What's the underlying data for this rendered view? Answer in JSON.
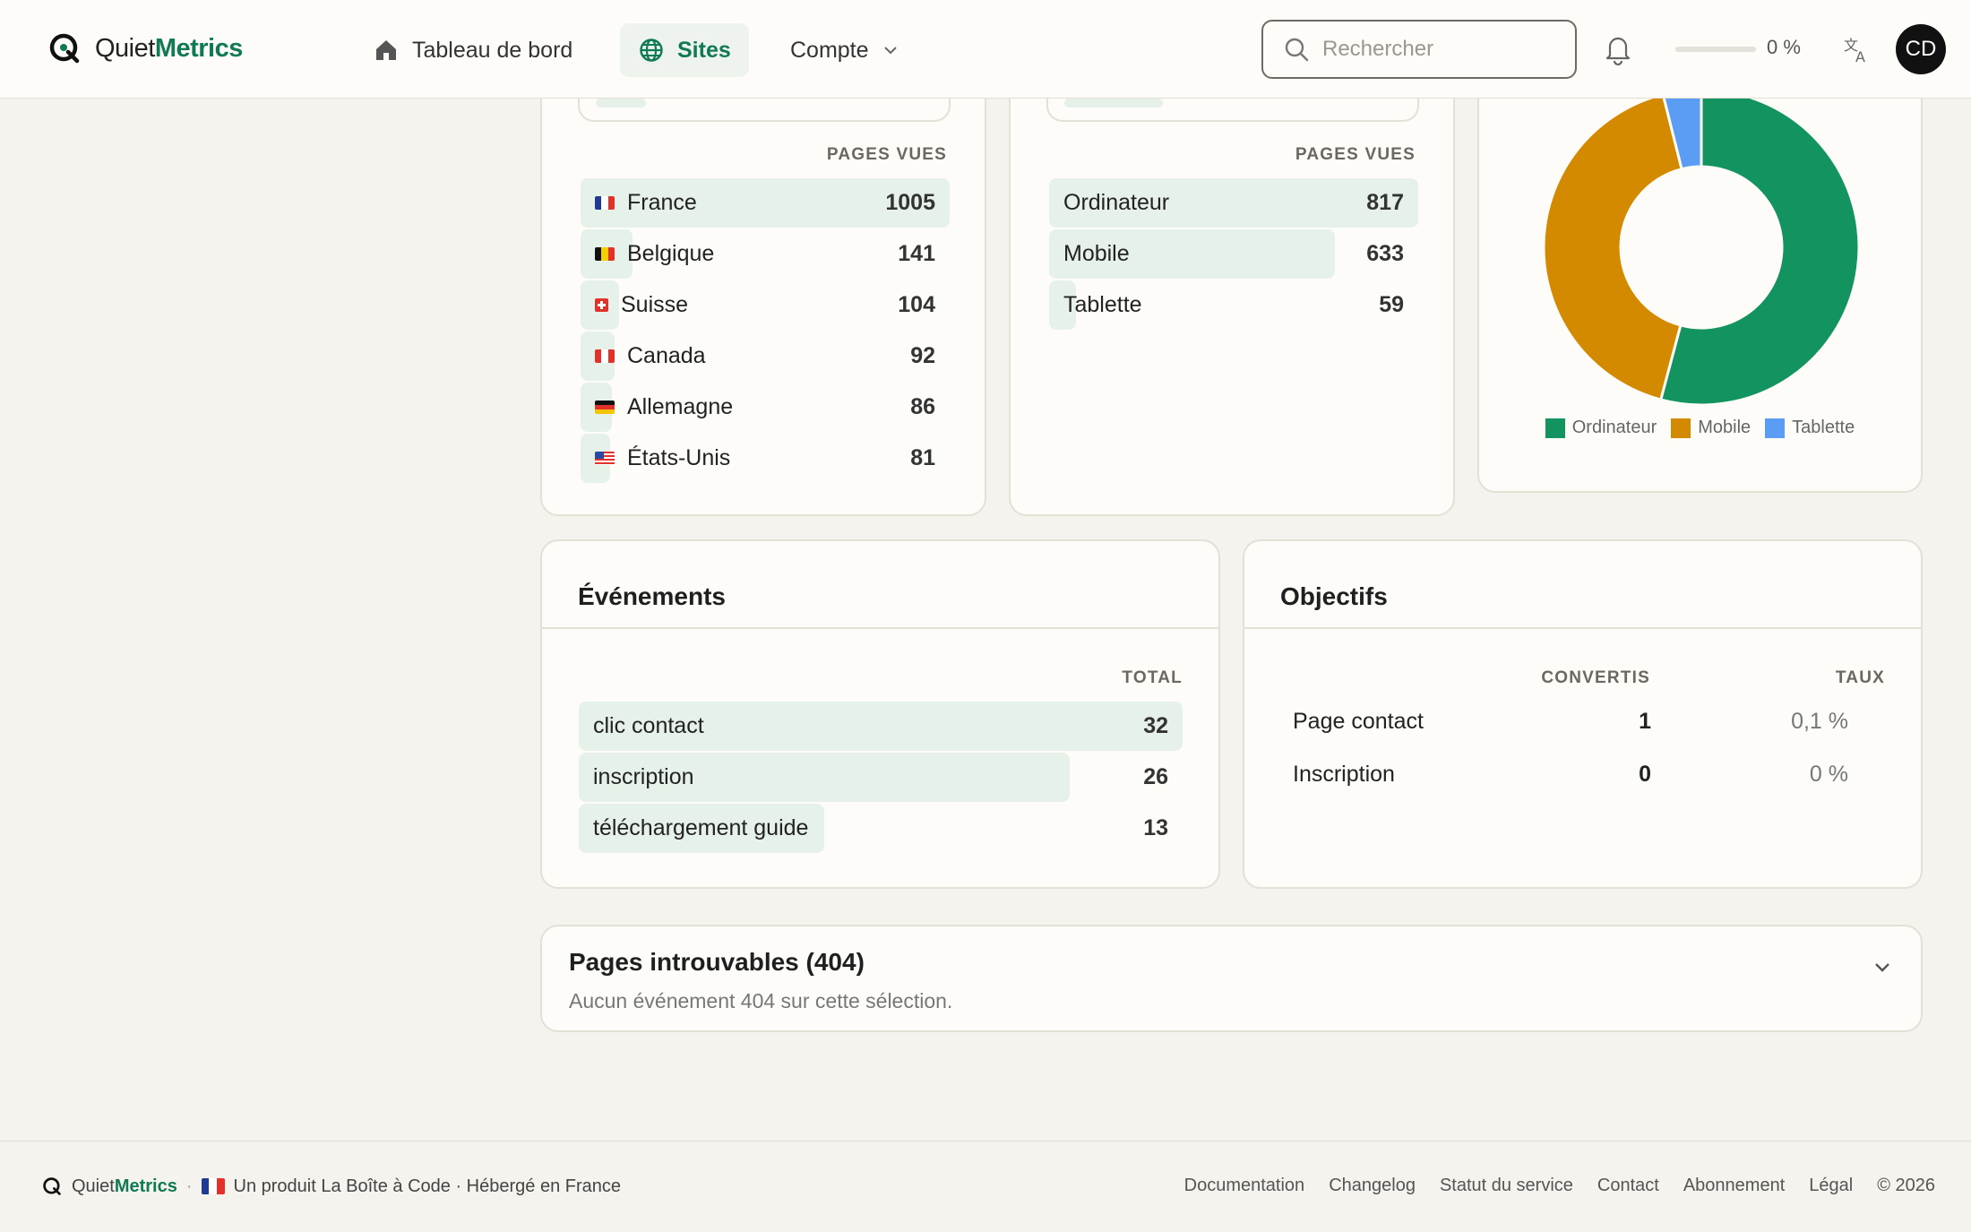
{
  "header": {
    "brand_plain": "Quiet",
    "brand_bold": "Metrics",
    "nav": {
      "dashboard": "Tableau de bord",
      "sites": "Sites",
      "account": "Compte"
    },
    "search_placeholder": "Rechercher",
    "progress_label": "0 %",
    "progress_fraction": 0,
    "avatar_initials": "CD"
  },
  "countries": {
    "column": "PAGES VUES",
    "rows": [
      {
        "name": "France",
        "value": "1005",
        "views": 1005,
        "flag": [
          "#1f3a93",
          "#ffffff",
          "#e2312b"
        ]
      },
      {
        "name": "Belgique",
        "value": "141",
        "views": 141,
        "flag": [
          "#111111",
          "#f5d000",
          "#e2312b"
        ]
      },
      {
        "name": "Suisse",
        "value": "104",
        "views": 104,
        "flag": "swiss"
      },
      {
        "name": "Canada",
        "value": "92",
        "views": 92,
        "flag": [
          "#e2312b",
          "#ffffff",
          "#e2312b"
        ]
      },
      {
        "name": "Allemagne",
        "value": "86",
        "views": 86,
        "flag": "germany"
      },
      {
        "name": "États-Unis",
        "value": "81",
        "views": 81,
        "flag": "usa"
      }
    ]
  },
  "devices": {
    "column": "PAGES VUES",
    "rows": [
      {
        "name": "Ordinateur",
        "value": "817",
        "views": 817
      },
      {
        "name": "Mobile",
        "value": "633",
        "views": 633
      },
      {
        "name": "Tablette",
        "value": "59",
        "views": 59
      }
    ]
  },
  "chart_data": {
    "type": "pie",
    "categories": [
      "Ordinateur",
      "Mobile",
      "Tablette"
    ],
    "values": [
      817,
      633,
      59
    ],
    "colors": [
      "#12935f",
      "#d48a00",
      "#5b9cf5"
    ],
    "legend_position": "bottom"
  },
  "events": {
    "title": "Événements",
    "column": "TOTAL",
    "rows": [
      {
        "name": "clic contact",
        "value": "32",
        "total": 32
      },
      {
        "name": "inscription",
        "value": "26",
        "total": 26
      },
      {
        "name": "téléchargement guide",
        "value": "13",
        "total": 13
      }
    ]
  },
  "goals": {
    "title": "Objectifs",
    "col_converted": "CONVERTIS",
    "col_rate": "TAUX",
    "rows": [
      {
        "name": "Page contact",
        "converted": "1",
        "rate": "0,1 %"
      },
      {
        "name": "Inscription",
        "converted": "0",
        "rate": "0 %"
      }
    ]
  },
  "notfound": {
    "title": "Pages introuvables (404)",
    "message": "Aucun événement 404 sur cette sélection."
  },
  "footer": {
    "brand_plain": "Quiet",
    "brand_bold": "Metrics",
    "tagline": "Un produit La Boîte à Code · Hébergé en France",
    "links": [
      "Documentation",
      "Changelog",
      "Statut du service",
      "Contact",
      "Abonnement",
      "Légal",
      "© 2026"
    ]
  },
  "colors": {
    "accent": "#0f7a53",
    "bar_fill": "#e6f1ea"
  }
}
